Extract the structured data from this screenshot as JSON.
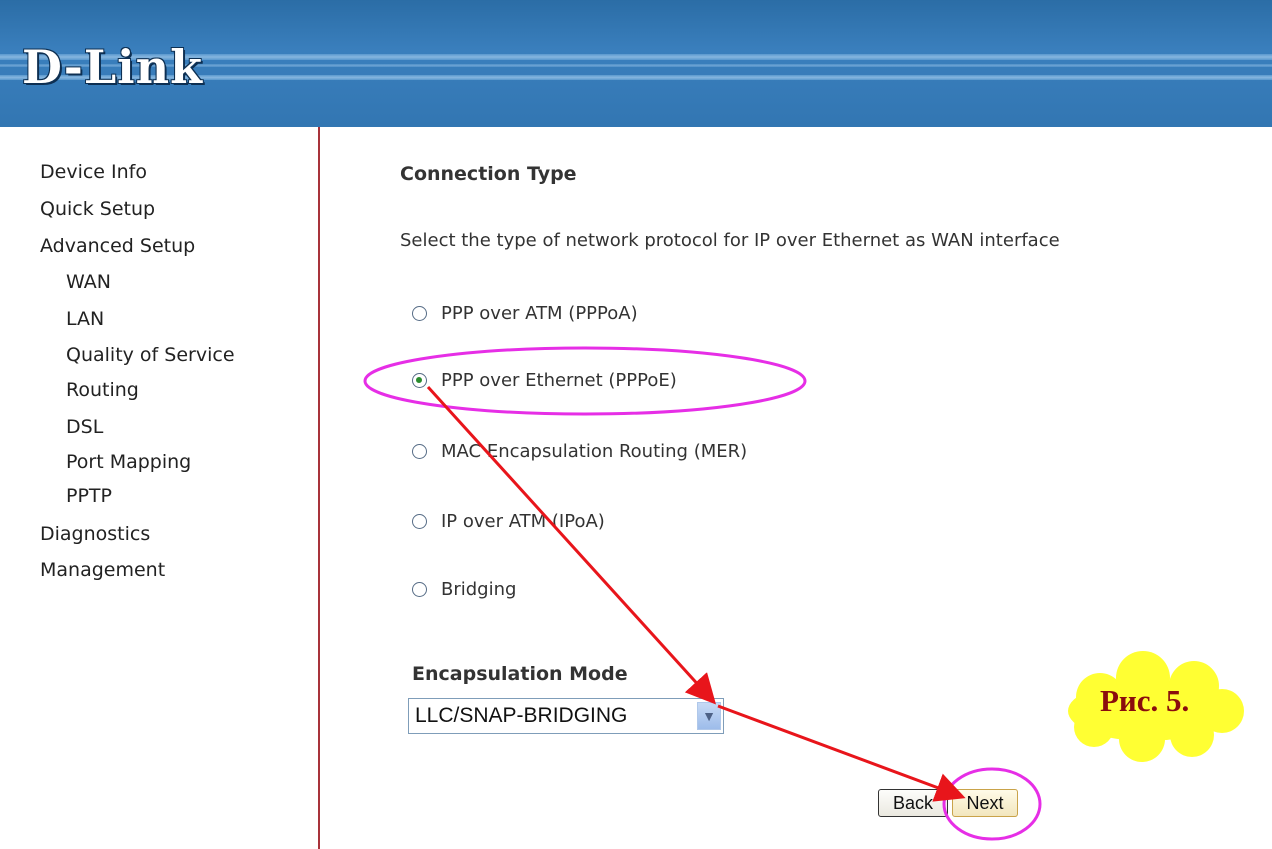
{
  "header": {
    "logo": "D-Link"
  },
  "sidebar": {
    "items": [
      {
        "label": "Device Info",
        "level": "top"
      },
      {
        "label": "Quick Setup",
        "level": "top"
      },
      {
        "label": "Advanced Setup",
        "level": "top"
      },
      {
        "label": "WAN",
        "level": "sub"
      },
      {
        "label": "LAN",
        "level": "sub"
      },
      {
        "label": "Quality of Service",
        "level": "sub"
      },
      {
        "label": "Routing",
        "level": "sub"
      },
      {
        "label": "DSL",
        "level": "sub"
      },
      {
        "label": "Port Mapping",
        "level": "sub"
      },
      {
        "label": "PPTP",
        "level": "sub"
      },
      {
        "label": "Diagnostics",
        "level": "top"
      },
      {
        "label": "Management",
        "level": "top"
      }
    ]
  },
  "main": {
    "title": "Connection Type",
    "description": "Select the type of network protocol for IP over Ethernet as WAN interface",
    "options": [
      {
        "label": "PPP over ATM (PPPoA)",
        "checked": false
      },
      {
        "label": "PPP over Ethernet (PPPoE)",
        "checked": true
      },
      {
        "label": "MAC Encapsulation Routing (MER)",
        "checked": false
      },
      {
        "label": "IP over ATM (IPoA)",
        "checked": false
      },
      {
        "label": "Bridging",
        "checked": false
      }
    ],
    "encapsulation": {
      "label": "Encapsulation Mode",
      "value": "LLC/SNAP-BRIDGING"
    },
    "buttons": {
      "back": "Back",
      "next": "Next"
    }
  },
  "annotation": {
    "callout": "Рис. 5.",
    "highlight_color": "#e62ee6",
    "arrow_color": "#e8151b",
    "callout_color": "#ffff33"
  }
}
